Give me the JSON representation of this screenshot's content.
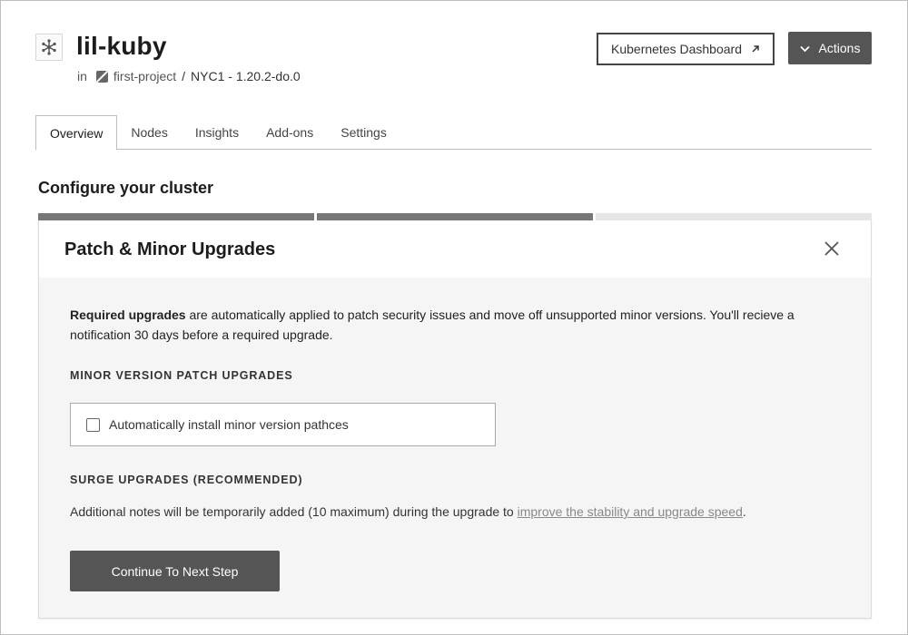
{
  "header": {
    "cluster_name": "lil-kuby",
    "in_label": "in",
    "project_name": "first-project",
    "separator": "/",
    "region_version": "NYC1 - 1.20.2-do.0",
    "dashboard_button_label": "Kubernetes Dashboard",
    "actions_button_label": "Actions"
  },
  "tabs": [
    {
      "label": "Overview",
      "active": true
    },
    {
      "label": "Nodes",
      "active": false
    },
    {
      "label": "Insights",
      "active": false
    },
    {
      "label": "Add-ons",
      "active": false
    },
    {
      "label": "Settings",
      "active": false
    }
  ],
  "section": {
    "title": "Configure your cluster",
    "progress": {
      "completed_steps": 2,
      "total_steps": 3
    }
  },
  "panel": {
    "title": "Patch & Minor Upgrades",
    "desc_bold": "Required upgrades",
    "desc_rest": " are automatically applied to patch security issues and move off unsupported minor versions. You'll recieve a notification 30 days before a required upgrade.",
    "minor_heading": "MINOR VERSION PATCH UPGRADES",
    "checkbox_label": "Automatically install minor version pathces",
    "checkbox_checked": false,
    "surge_heading": "SURGE UPGRADES (RECOMMENDED)",
    "surge_text": "Additional notes will be temporarily added (10 maximum) during the upgrade to ",
    "surge_link": "improve the stability and upgrade speed",
    "surge_end": ".",
    "continue_label": "Continue To Next Step"
  },
  "colors": {
    "button_dark": "#555555",
    "progress_done": "#777777",
    "progress_pending": "#e6e6e6",
    "panel_bg": "#f5f5f5"
  }
}
